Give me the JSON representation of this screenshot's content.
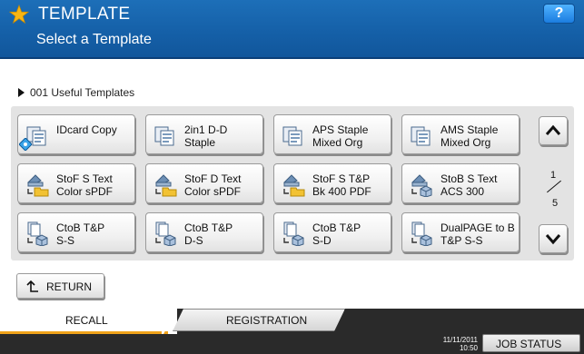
{
  "header": {
    "title": "TEMPLATE",
    "subtitle": "Select a Template",
    "help_label": "?"
  },
  "breadcrumb": {
    "text": "001  Useful Templates"
  },
  "templates": [
    {
      "label": "IDcard Copy",
      "icon": "copy-icon"
    },
    {
      "label": "2in1 D-D\nStaple",
      "icon": "copy-icon"
    },
    {
      "label": "APS Staple\nMixed Org",
      "icon": "copy-icon"
    },
    {
      "label": "AMS Staple\nMixed Org",
      "icon": "copy-icon"
    },
    {
      "label": "StoF S Text\nColor sPDF",
      "icon": "scan-to-folder-icon"
    },
    {
      "label": "StoF D Text\nColor sPDF",
      "icon": "scan-to-folder-icon"
    },
    {
      "label": "StoF S T&P\nBk 400 PDF",
      "icon": "scan-to-folder-icon"
    },
    {
      "label": "StoB S Text\nACS 300",
      "icon": "scan-to-box-icon"
    },
    {
      "label": "CtoB T&P\nS-S",
      "icon": "copy-to-box-icon"
    },
    {
      "label": "CtoB T&P\nD-S",
      "icon": "copy-to-box-icon"
    },
    {
      "label": "CtoB T&P\nS-D",
      "icon": "copy-to-box-icon"
    },
    {
      "label": "DualPAGE to B\nT&P S-S",
      "icon": "copy-to-box-icon"
    }
  ],
  "pager": {
    "current": "1",
    "total": "5"
  },
  "return_label": "RETURN",
  "tabs": {
    "recall": "RECALL",
    "registration": "REGISTRATION"
  },
  "status": {
    "date": "11/11/2011",
    "time": "10:50",
    "job_status_label": "JOB STATUS"
  },
  "colors": {
    "header": "#1560a8",
    "accent": "#f0a21a",
    "star": "#f7b514"
  }
}
